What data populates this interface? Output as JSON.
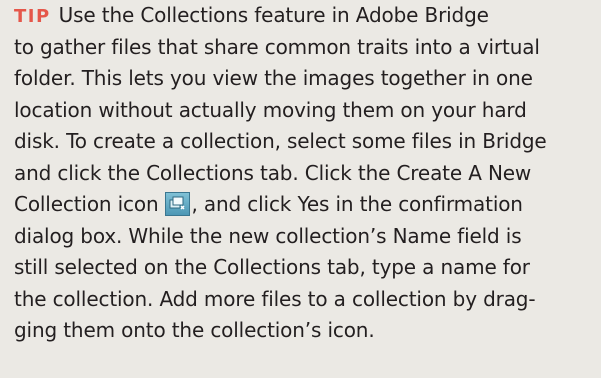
{
  "tip": {
    "label": "TIP",
    "lines": [
      "Use the Collections feature in Adobe Bridge",
      "to gather files that share common traits into a virtual",
      "folder. This lets you view the images together in one",
      "location without actually moving them on your hard",
      "disk. To create a collection, select some files in Bridge",
      "and click the Collections tab. Click the Create A New",
      "Collection icon",
      ", and click Yes in the confirmation",
      "dialog box. While the new collection’s Name field is",
      "still selected on the Collections tab, type a name for",
      "the collection. Add more files to a collection by drag-",
      "ging them onto the collection’s icon."
    ],
    "icon": "new-collection-icon"
  }
}
